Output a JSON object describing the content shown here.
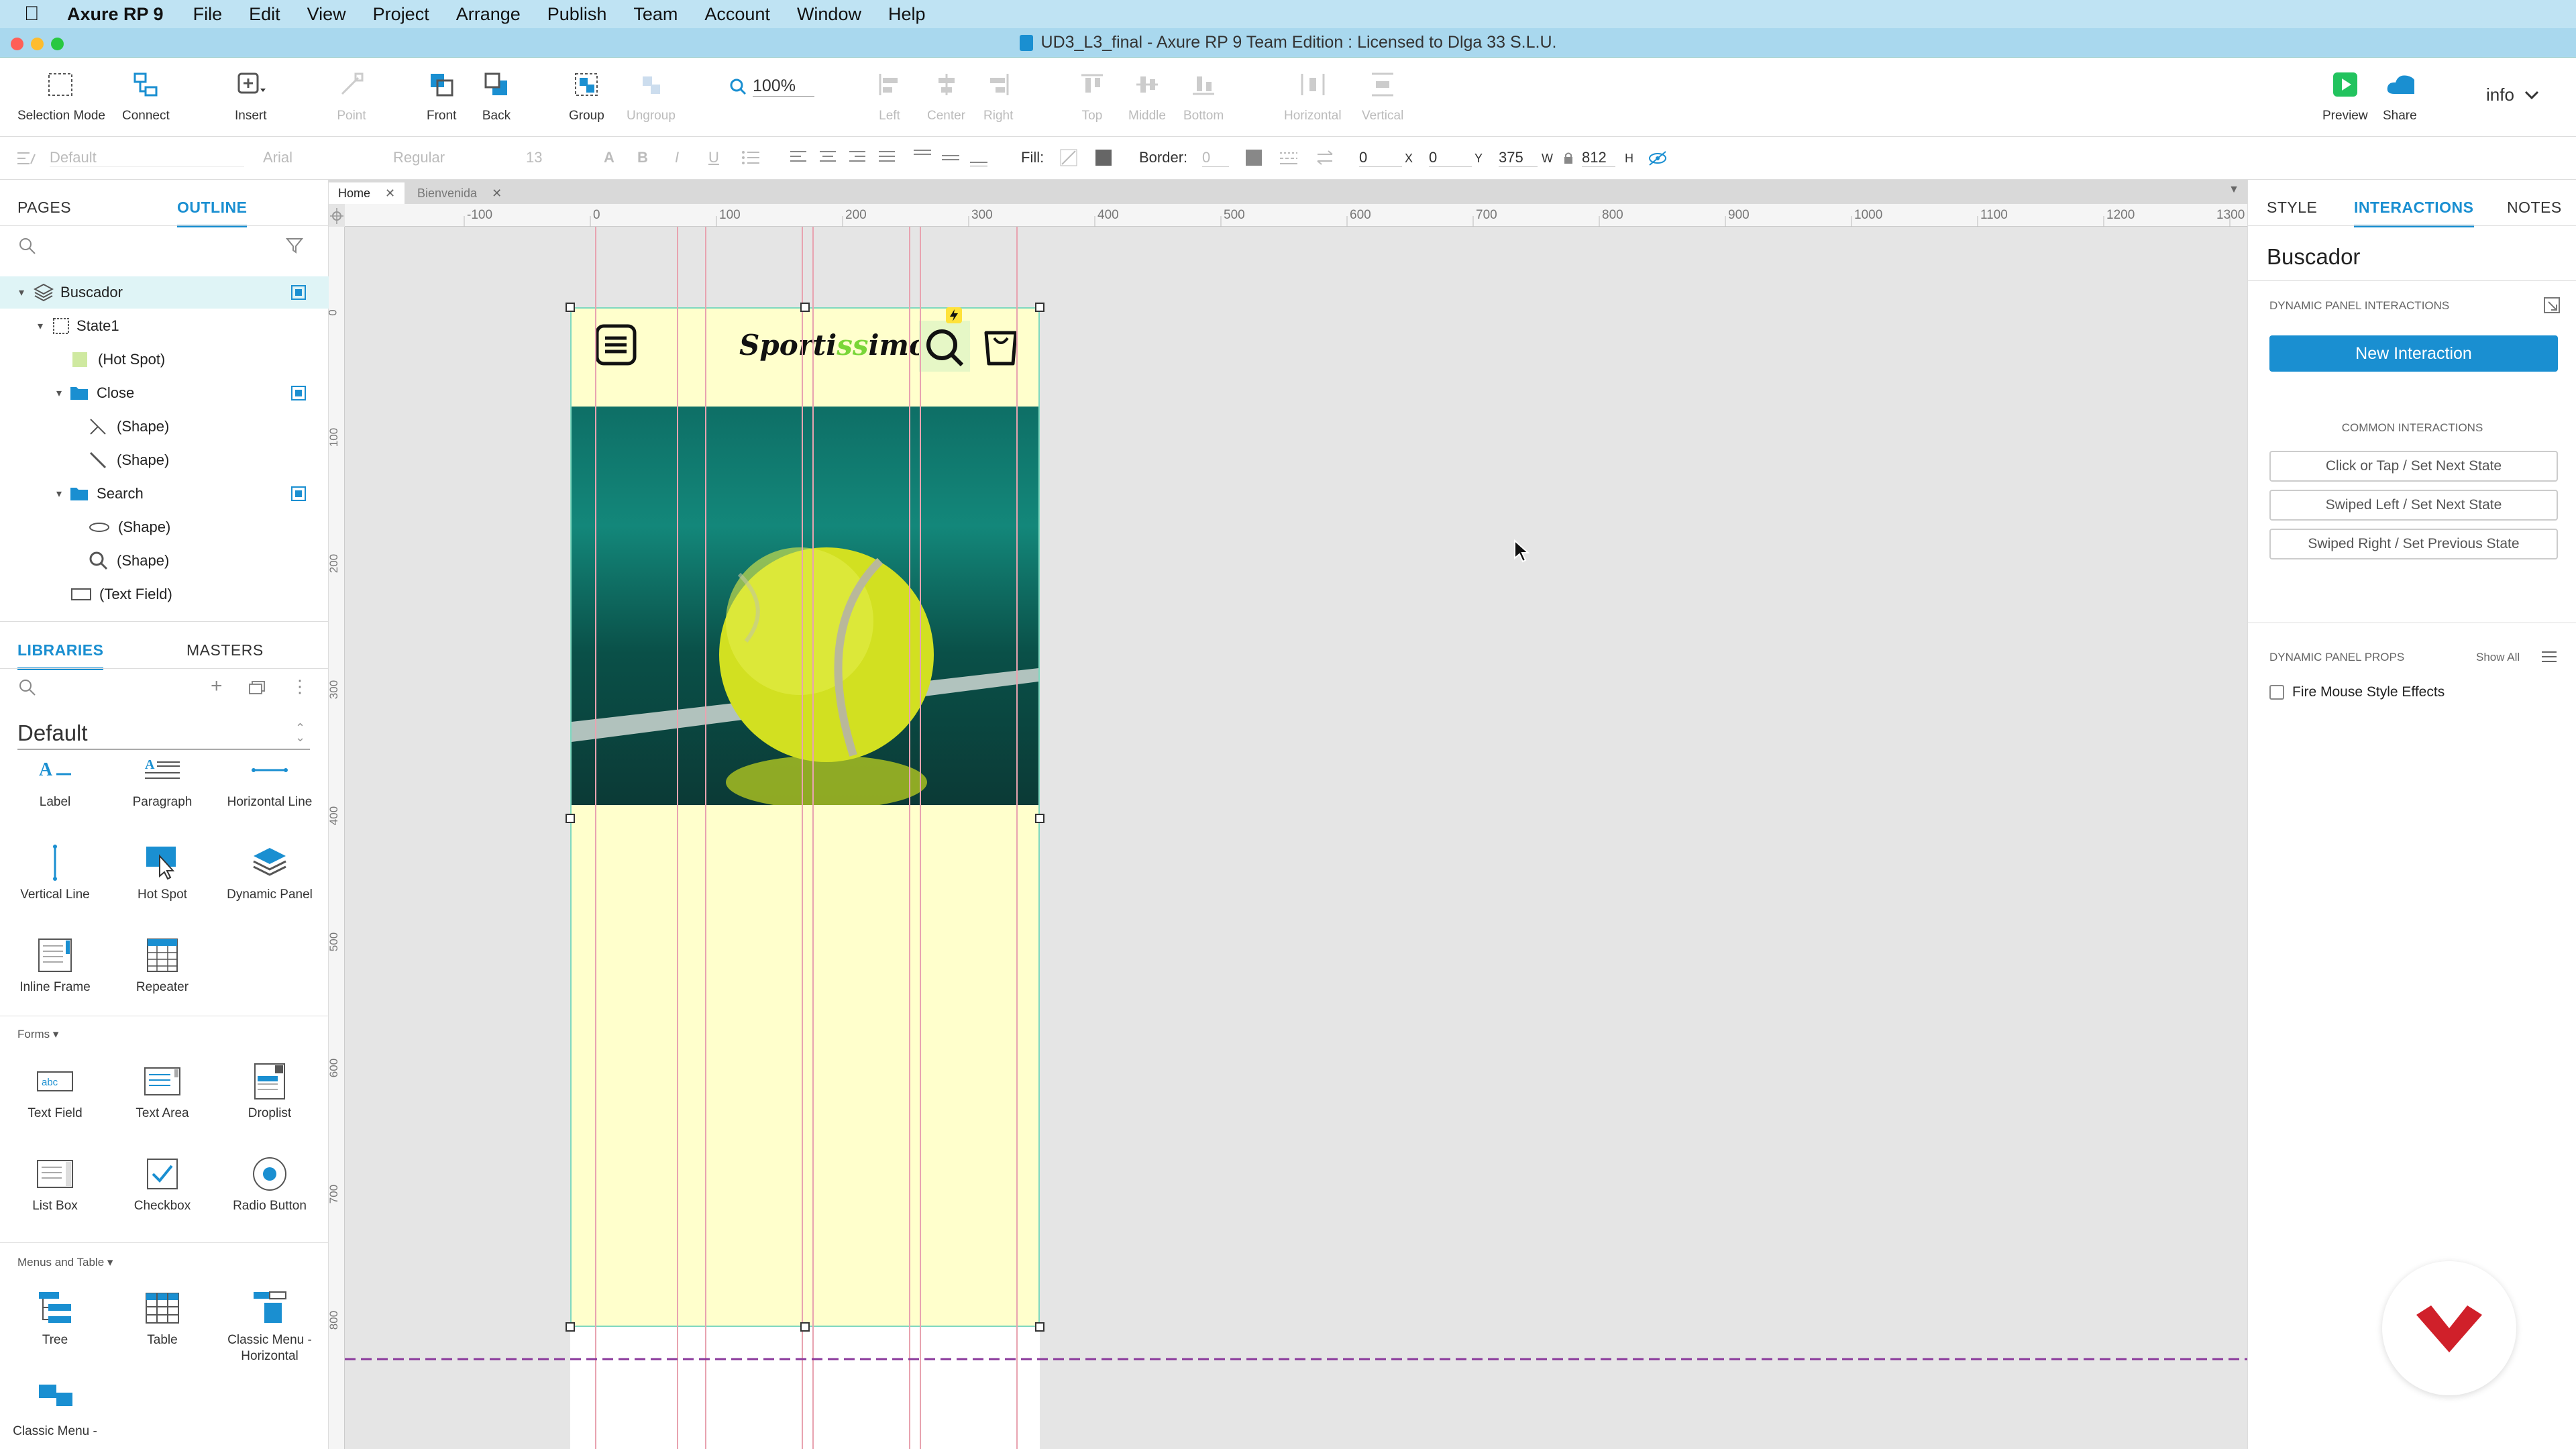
{
  "menubar": {
    "app_name": "Axure RP 9",
    "items": [
      "File",
      "Edit",
      "View",
      "Project",
      "Arrange",
      "Publish",
      "Team",
      "Account",
      "Window",
      "Help"
    ]
  },
  "window": {
    "title": "UD3_L3_final - Axure RP 9 Team Edition : Licensed to Dlga 33 S.L.U."
  },
  "toolbar": {
    "selection_mode": "Selection Mode",
    "connect": "Connect",
    "insert": "Insert",
    "point": "Point",
    "front": "Front",
    "back": "Back",
    "group": "Group",
    "ungroup": "Ungroup",
    "zoom": "100%",
    "left": "Left",
    "center": "Center",
    "right": "Right",
    "top": "Top",
    "middle": "Middle",
    "bottom": "Bottom",
    "horizontal": "Horizontal",
    "vertical": "Vertical",
    "preview": "Preview",
    "share": "Share",
    "user": "info"
  },
  "formatbar": {
    "style": "Default",
    "font": "Arial",
    "weight": "Regular",
    "size": "13",
    "fill_label": "Fill:",
    "border_label": "Border:",
    "border_value": "0",
    "x": "0",
    "x_label": "X",
    "y": "0",
    "y_label": "Y",
    "w": "375",
    "w_label": "W",
    "h": "812",
    "h_label": "H"
  },
  "left": {
    "tabs": {
      "pages": "PAGES",
      "outline": "OUTLINE"
    },
    "outline": [
      {
        "label": "Buscador",
        "level": 0
      },
      {
        "label": "State1",
        "level": 1
      },
      {
        "label": "(Hot Spot)",
        "level": 2
      },
      {
        "label": "Close",
        "level": 2
      },
      {
        "label": "(Shape)",
        "level": 3
      },
      {
        "label": "(Shape)",
        "level": 3
      },
      {
        "label": "Search",
        "level": 2
      },
      {
        "label": "(Shape)",
        "level": 3
      },
      {
        "label": "(Shape)",
        "level": 3
      },
      {
        "label": "(Text Field)",
        "level": 2
      }
    ],
    "lib_tabs": {
      "libraries": "LIBRARIES",
      "masters": "MASTERS"
    },
    "library_name": "Default",
    "basic": [
      "Label",
      "Paragraph",
      "Horizontal Line",
      "Vertical Line",
      "Hot Spot",
      "Dynamic Panel",
      "Inline Frame",
      "Repeater"
    ],
    "forms_title": "Forms ▾",
    "forms": [
      "Text Field",
      "Text Area",
      "Droplist",
      "List Box",
      "Checkbox",
      "Radio Button"
    ],
    "menus_title": "Menus and Table ▾",
    "menus": [
      "Tree",
      "Table",
      "Classic Menu - Horizontal",
      "Classic Menu -"
    ]
  },
  "canvas": {
    "tabs": [
      "Home",
      "Bienvenida"
    ],
    "ruler_h": [
      "-100",
      "0",
      "100",
      "200",
      "300",
      "400",
      "500",
      "600",
      "700",
      "800",
      "900",
      "1000",
      "1100",
      "1200",
      "1300"
    ],
    "ruler_v": [
      "0",
      "100",
      "200",
      "300",
      "400",
      "500",
      "600",
      "700",
      "800"
    ],
    "brand_prefix": "Sporti",
    "brand_highlight": "ss",
    "brand_suffix": "imo"
  },
  "right": {
    "tabs": {
      "style": "STYLE",
      "interactions": "INTERACTIONS",
      "notes": "NOTES"
    },
    "widget_name": "Buscador",
    "dp_interactions": "DYNAMIC PANEL INTERACTIONS",
    "new_interaction": "New Interaction",
    "common_title": "COMMON INTERACTIONS",
    "common": [
      "Click or Tap / Set Next State",
      "Swiped Left / Set Next State",
      "Swiped Right / Set Previous State"
    ],
    "props_title": "DYNAMIC PANEL PROPS",
    "show_all": "Show All",
    "fire_mouse": "Fire Mouse Style Effects"
  },
  "colors": {
    "accent": "#1a8fd1",
    "panel_fill": "#ffffcc",
    "brand_green": "#7ad638",
    "guide": "#e8a3b0"
  }
}
